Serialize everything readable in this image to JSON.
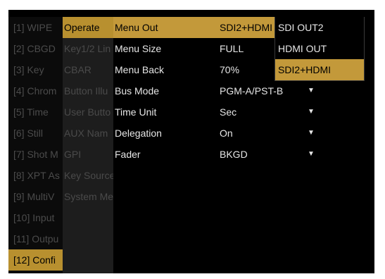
{
  "menu_col1": [
    "[1] WIPE",
    "[2] CBGD",
    "[3] Key",
    "[4] Chrom",
    "[5] Time",
    "[6] Still",
    "[7] Shot M",
    "[8] XPT As",
    "[9] MultiV",
    "[10] Input",
    "[11] Outpu",
    "[12] Confi"
  ],
  "menu_col2": [
    "Operate",
    "Key1/2 Lin",
    "CBAR",
    "Button Illu",
    "User Butto",
    "AUX Nam",
    "GPI",
    "Key Source",
    "System Me"
  ],
  "settings": [
    {
      "name": "Menu Out",
      "value": "SDI2+HDMI",
      "dropdown": false
    },
    {
      "name": "Menu Size",
      "value": "FULL",
      "dropdown": false
    },
    {
      "name": "Menu Back",
      "value": "70%",
      "dropdown": false
    },
    {
      "name": "Bus Mode",
      "value": "PGM-A/PST-B",
      "dropdown": true
    },
    {
      "name": "Time Unit",
      "value": "Sec",
      "dropdown": true
    },
    {
      "name": "Delegation",
      "value": "On",
      "dropdown": true
    },
    {
      "name": "Fader",
      "value": "BKGD",
      "dropdown": true
    }
  ],
  "dropdown_arrow": "▼",
  "popup_options": [
    "SDI OUT2",
    "HDMI OUT",
    "SDI2+HDMI"
  ],
  "selected": {
    "col1": 11,
    "col2": 0,
    "setting": 0,
    "popup_option": 2
  },
  "colors": {
    "highlight": "#c3993a",
    "dim_text": "#4b4b4b",
    "text": "#e6e6e6"
  }
}
